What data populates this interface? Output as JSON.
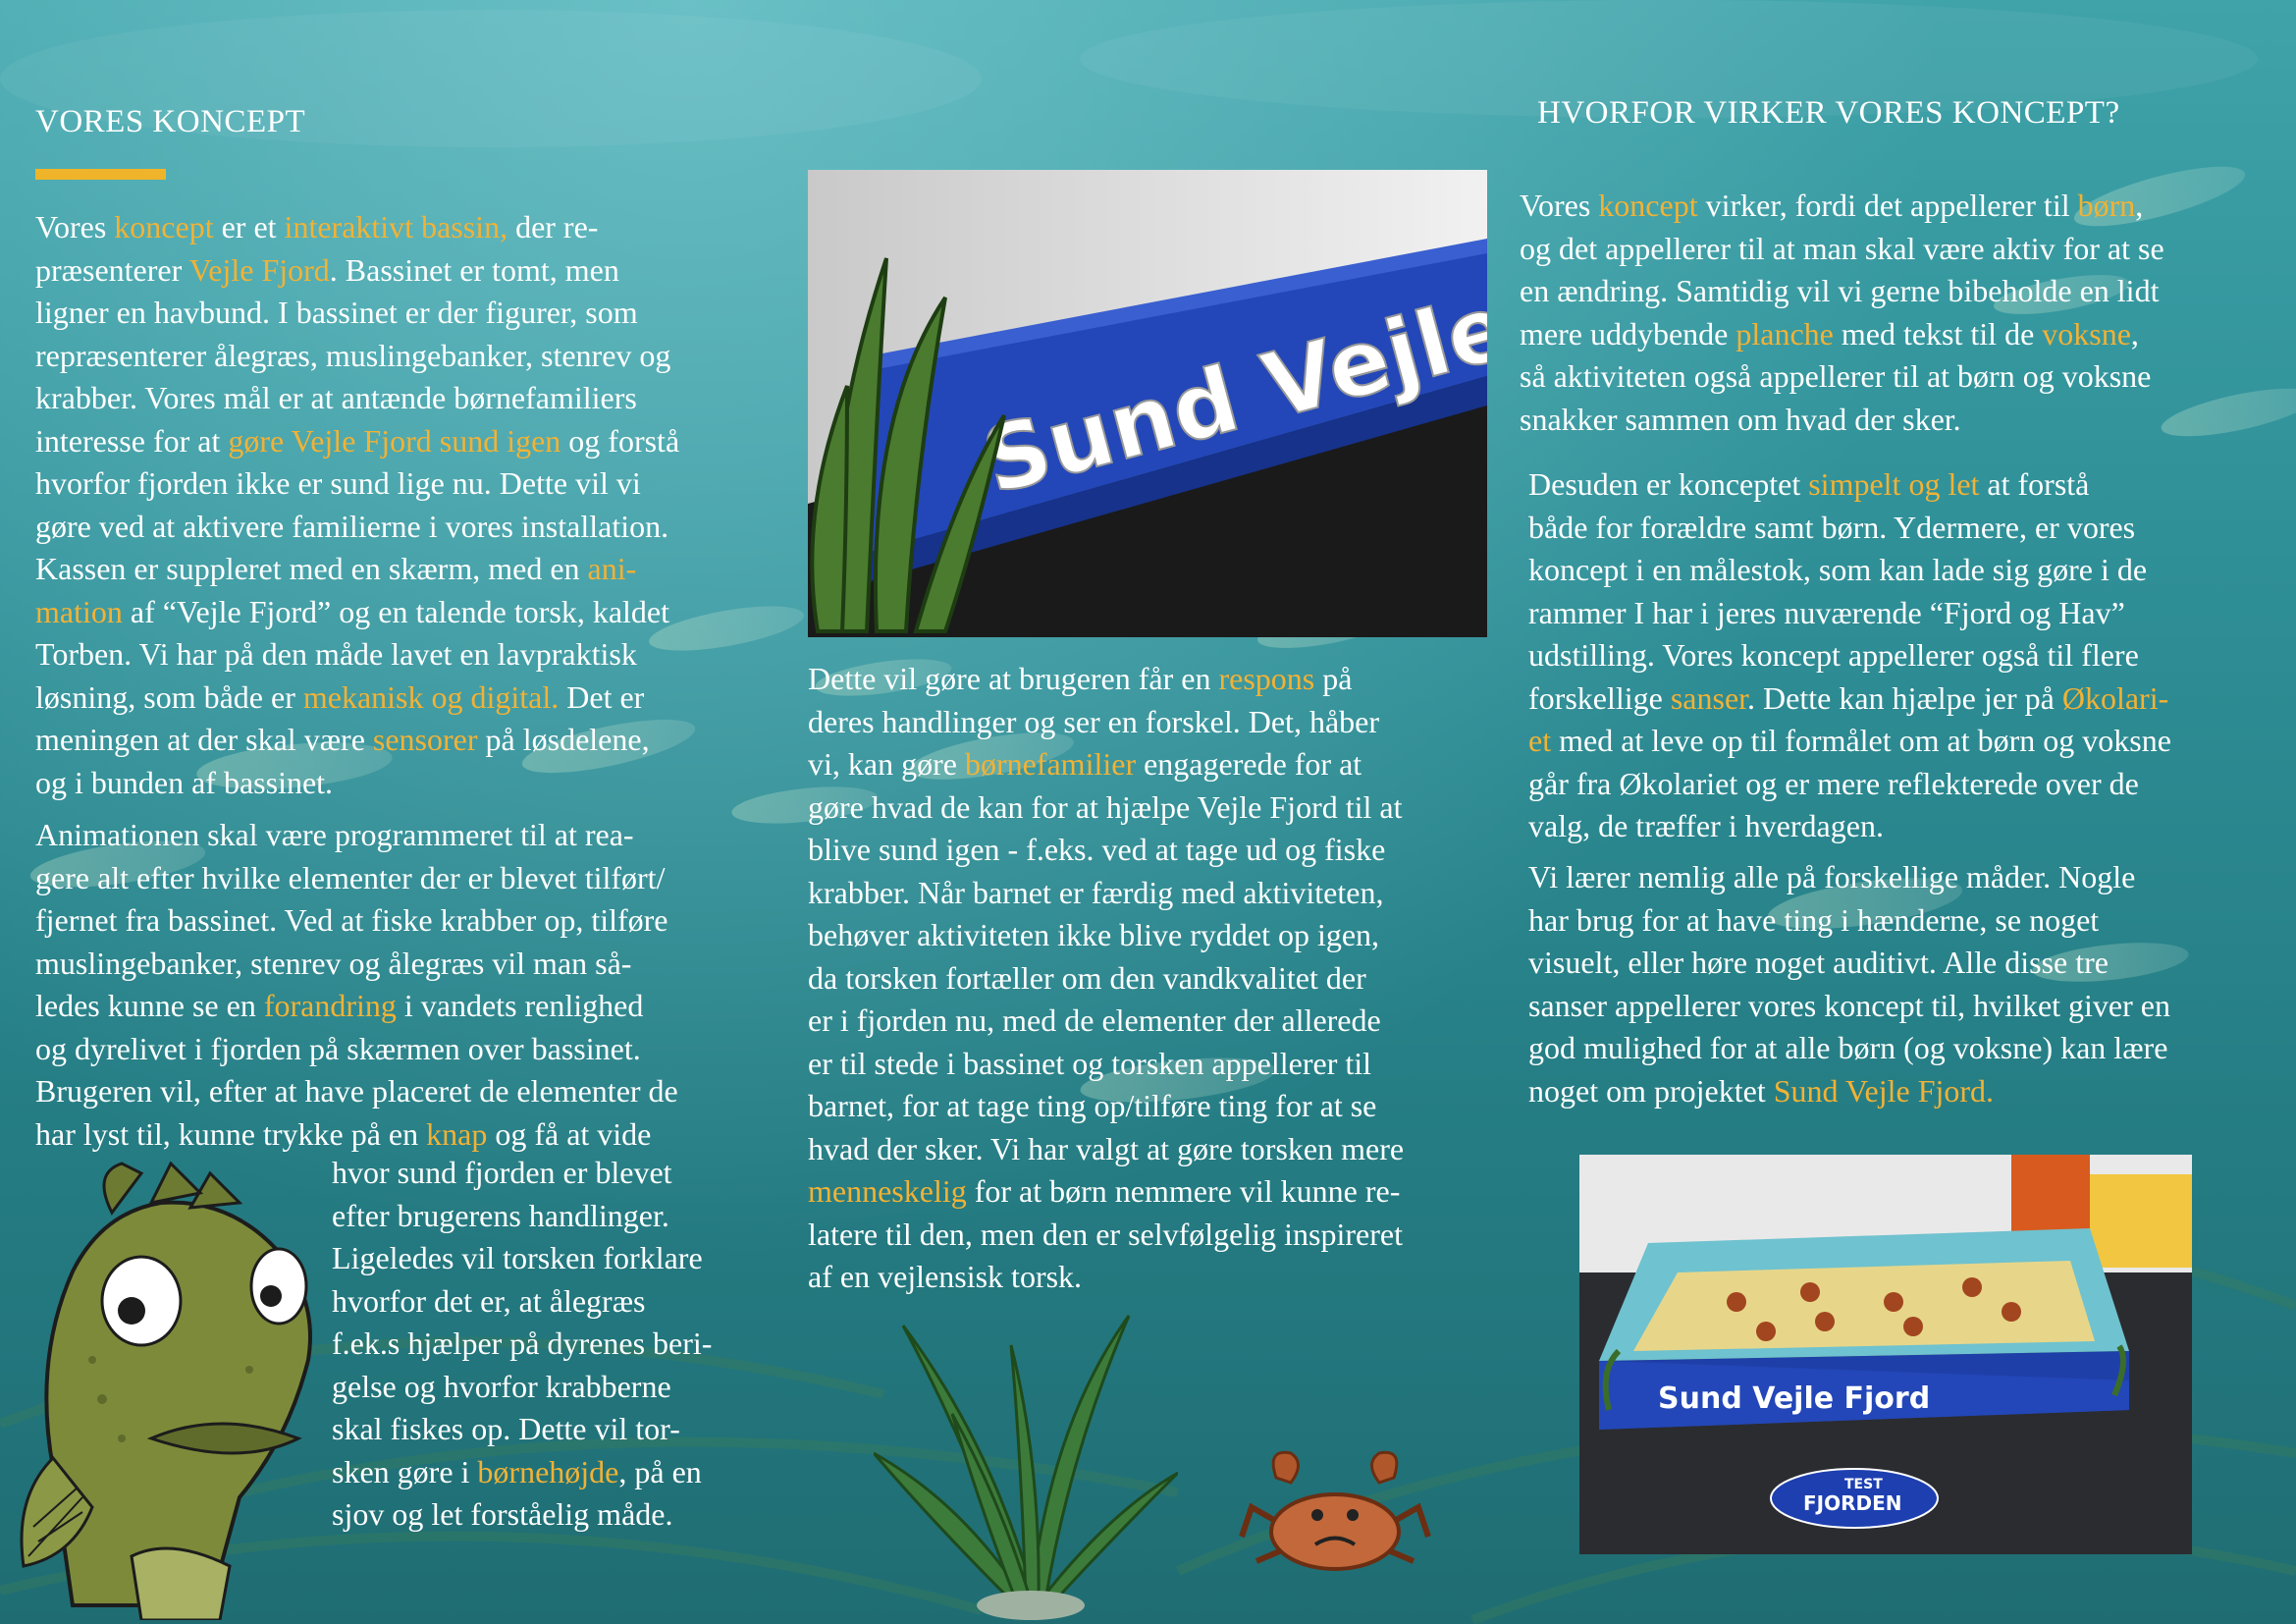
{
  "left": {
    "heading": "VORES KONCEPT",
    "p1": [
      {
        "t": "Vores "
      },
      {
        "t": "koncept",
        "hl": true
      },
      {
        "t": " er et "
      },
      {
        "t": "interaktivt bassin,",
        "hl": true
      },
      {
        "t": " der re-\npræsenterer "
      },
      {
        "t": "Vejle Fjord",
        "hl": true
      },
      {
        "t": ". Bassinet er tomt, men\nligner en havbund. I bassinet er der figurer, som\nrepræsenterer ålegræs, muslingebanker, stenrev og\nkrabber. Vores mål er at antænde børnefamiliers\ninteresse for at "
      },
      {
        "t": "gøre Vejle Fjord sund igen",
        "hl": true
      },
      {
        "t": " og forstå\nhvorfor fjorden ikke er sund lige nu. Dette vil vi\ngøre ved at aktivere familierne i vores installation.\nKassen er suppleret med en skærm, med en "
      },
      {
        "t": "ani-\nmation",
        "hl": true
      },
      {
        "t": " af “Vejle Fjord” og en talende torsk, kaldet\nTorben. Vi har på den måde lavet en lavpraktisk\nløsning, som både er "
      },
      {
        "t": "mekanisk og digital.",
        "hl": true
      },
      {
        "t": " Det er\nmeningen at der skal være "
      },
      {
        "t": "sensorer",
        "hl": true
      },
      {
        "t": " på løsdelene,\nog i bunden af bassinet."
      }
    ],
    "p2": [
      {
        "t": "Animationen skal være programmeret til at rea-\ngere alt efter hvilke elementer der er blevet tilført/\nfjernet fra bassinet. Ved at fiske krabber op, tilføre\nmuslingebanker, stenrev og ålegræs vil man så-\nledes kunne se en "
      },
      {
        "t": "forandring",
        "hl": true
      },
      {
        "t": " i vandets renlighed\nog dyrelivet i fjorden på skærmen over bassinet.\nBrugeren vil, efter at have placeret de elementer de\nhar lyst til, kunne trykke på en "
      },
      {
        "t": "knap",
        "hl": true
      },
      {
        "t": " og få at vide"
      }
    ],
    "p3": [
      {
        "t": "hvor sund fjorden er blevet\nefter brugerens handlinger.\nLigeledes vil torsken forklare\nhvorfor det er, at ålegræs\nf.ek.s hjælper på dyrenes beri-\ngelse og hvorfor krabberne\nskal fiskes op. Dette vil tor-\nsken gøre i "
      },
      {
        "t": "børnehøjde",
        "hl": true
      },
      {
        "t": ", på en\nsjov og let forståelig måde."
      }
    ]
  },
  "middle": {
    "photo_sign_text": "Sund Vejle Fj",
    "p1": [
      {
        "t": "Dette vil gøre at brugeren får en "
      },
      {
        "t": "respons",
        "hl": true
      },
      {
        "t": " på\nderes handlinger og ser en forskel. Det, håber\nvi, kan gøre "
      },
      {
        "t": "børnefamilier",
        "hl": true
      },
      {
        "t": " engagerede for at\ngøre hvad de kan for at hjælpe Vejle Fjord til at\nblive sund igen - f.eks. ved at tage ud og fiske\nkrabber. Når barnet er færdig med aktiviteten,\nbehøver aktiviteten ikke blive ryddet op igen,\nda torsken fortæller om den vandkvalitet der\ner i fjorden nu, med de elementer der allerede\ner til stede i bassinet og torsken appellerer til\nbarnet, for at tage ting op/tilføre ting for at se\nhvad der sker. Vi har valgt at gøre torsken mere\n"
      },
      {
        "t": "menneskelig",
        "hl": true
      },
      {
        "t": " for at børn nemmere vil kunne re-\nlatere til den, men den er selvfølgelig inspireret\naf en vejlensisk torsk."
      }
    ]
  },
  "right": {
    "heading": "HVORFOR VIRKER VORES KONCEPT?",
    "p1": [
      {
        "t": "Vores "
      },
      {
        "t": "koncept",
        "hl": true
      },
      {
        "t": " virker, fordi det appellerer til "
      },
      {
        "t": "børn",
        "hl": true
      },
      {
        "t": ",\nog det appellerer til at man skal være aktiv for at se\nen ændring. Samtidig vil vi gerne bibeholde en lidt\nmere uddybende "
      },
      {
        "t": "planche",
        "hl": true
      },
      {
        "t": " med tekst til de "
      },
      {
        "t": "voksne",
        "hl": true
      },
      {
        "t": ",\nså aktiviteten også appellerer til at børn og voksne\nsnakker sammen om hvad der sker."
      }
    ],
    "p2": [
      {
        "t": "Desuden er konceptet "
      },
      {
        "t": "simpelt og let",
        "hl": true
      },
      {
        "t": " at forstå\nbåde for forældre samt børn. Ydermere, er vores\nkoncept i en målestok, som kan lade sig gøre i de\nrammer I har i jeres nuværende “Fjord og Hav”\nudstilling. Vores koncept appellerer også til flere\nforskellige "
      },
      {
        "t": "sanser",
        "hl": true
      },
      {
        "t": ". Dette kan hjælpe jer på "
      },
      {
        "t": "Økolari-\net",
        "hl": true
      },
      {
        "t": " med at leve op til formålet om at børn og voksne\ngår fra Økolariet og er mere reflekterede over de\nvalg, de træffer i hverdagen."
      }
    ],
    "p3": [
      {
        "t": "Vi lærer nemlig alle på forskellige måder. Nogle\nhar brug for at have ting i hænderne, se noget\nvisuelt, eller høre noget auditivt. Alle disse tre\nsanser appellerer vores koncept til, hvilket giver en\ngod mulighed for at alle børn (og voksne) kan lære\nnoget om projektet "
      },
      {
        "t": "Sund Vejle Fjord.",
        "hl": true
      }
    ],
    "photo_box_label": "Sund Vejle Fjord",
    "photo_lid_label_1": "TEST",
    "photo_lid_label_2": "FJORDEN"
  },
  "colors": {
    "accent": "#f2b235",
    "text": "#ffffff",
    "water": "#2f8f97"
  },
  "illustrations": [
    "cod-fish-illustration",
    "eelgrass-illustration",
    "crab-illustration"
  ]
}
